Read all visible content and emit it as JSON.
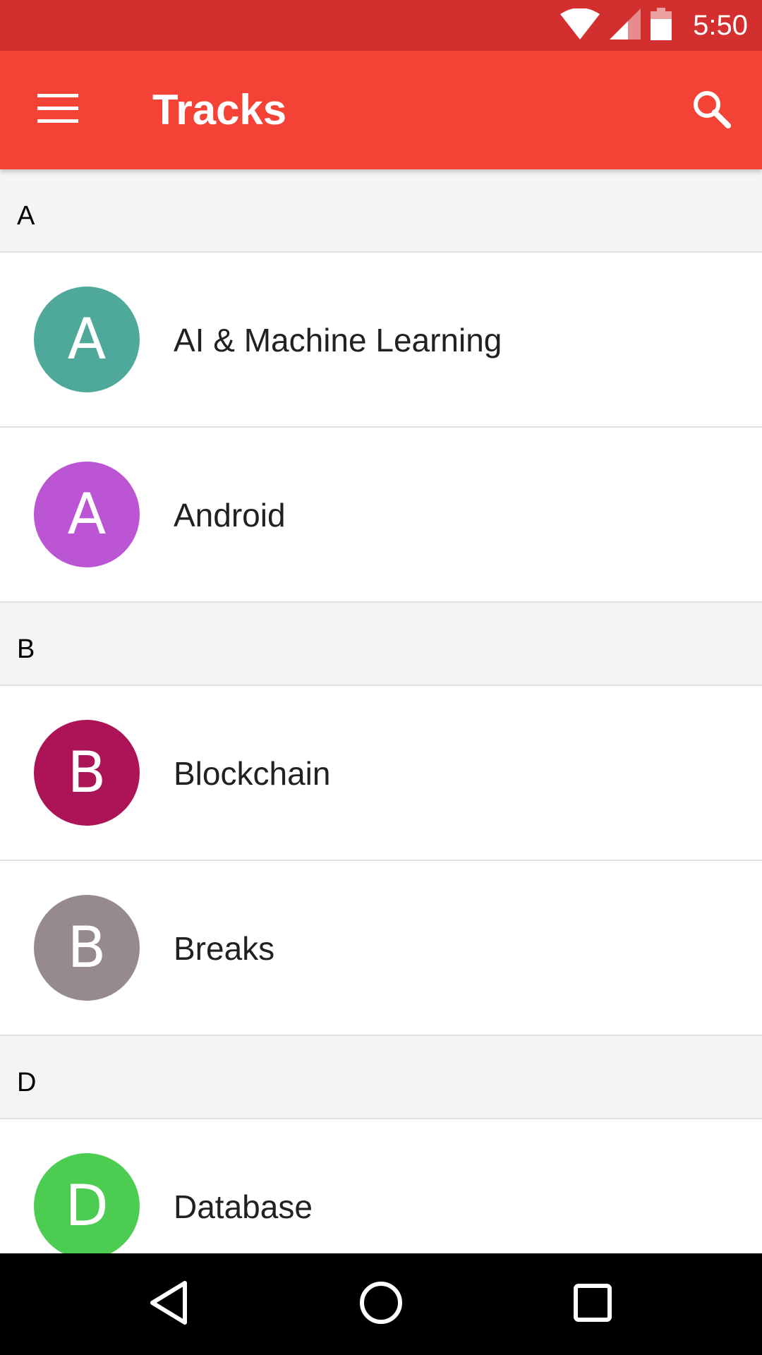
{
  "status_bar": {
    "time": "5:50",
    "icons": [
      "wifi-icon",
      "signal-icon",
      "battery-icon"
    ],
    "color": "#d32f2f"
  },
  "toolbar": {
    "title": "Tracks",
    "menu_icon": "menu-icon",
    "search_icon": "search-icon",
    "color": "#f44336"
  },
  "sections": [
    {
      "header": "A",
      "tracks": [
        {
          "initial": "A",
          "name": "AI & Machine Learning",
          "color": "#4fa99a"
        },
        {
          "initial": "A",
          "name": "Android",
          "color": "#bb55d3"
        }
      ]
    },
    {
      "header": "B",
      "tracks": [
        {
          "initial": "B",
          "name": "Blockchain",
          "color": "#ad1457"
        },
        {
          "initial": "B",
          "name": "Breaks",
          "color": "#978a8f"
        }
      ]
    },
    {
      "header": "D",
      "tracks": [
        {
          "initial": "D",
          "name": "Database",
          "color": "#4ccd51"
        }
      ]
    }
  ],
  "nav_bar": {
    "icons": [
      "back-icon",
      "home-icon",
      "recents-icon"
    ]
  }
}
